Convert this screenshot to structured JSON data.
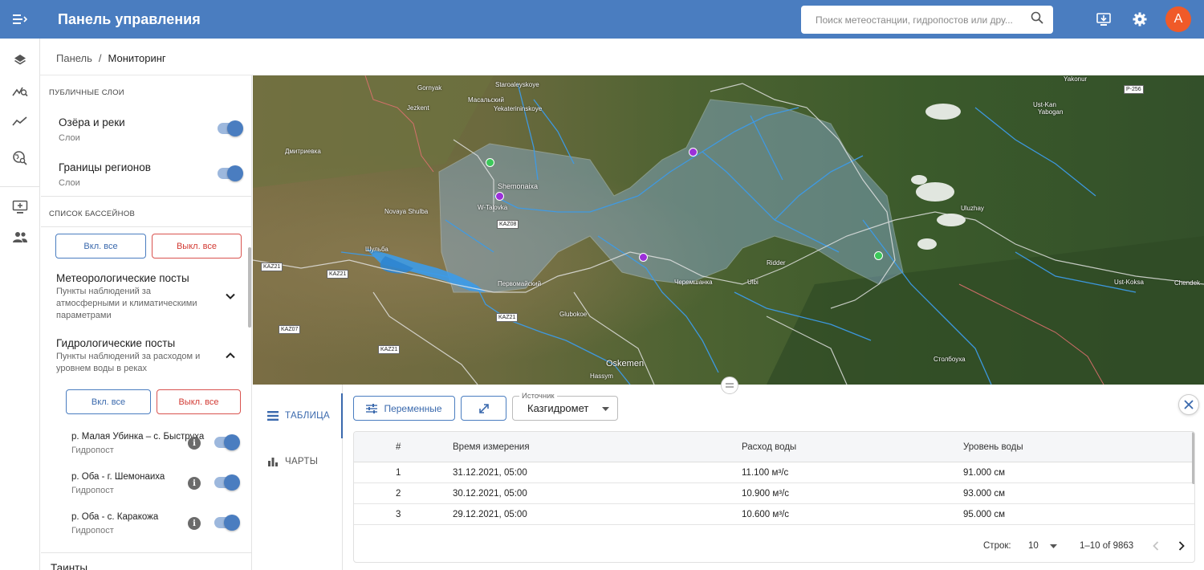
{
  "header": {
    "title": "Панель управления",
    "search_placeholder": "Поиск метеостанции, гидропостов или дру...",
    "avatar_letter": "A"
  },
  "breadcrumb": {
    "root": "Панель",
    "sep": "/",
    "current": "Мониторинг"
  },
  "layers": {
    "public_title": "ПУБЛИЧНЫЕ СЛОИ",
    "items": [
      {
        "name": "Озёра и реки",
        "sub": "Слои",
        "on": true
      },
      {
        "name": "Границы регионов",
        "sub": "Слои",
        "on": true
      }
    ],
    "basins_title": "СПИСОК БАССЕЙНОВ",
    "enable_all": "Вкл. все",
    "disable_all": "Выкл. все",
    "groups": [
      {
        "title": "Метеорологические посты",
        "desc": "Пункты наблюдений за атмосферными и климатическими параметрами",
        "expanded": false
      },
      {
        "title": "Гидрологические посты",
        "desc": "Пункты наблюдений за расходом и уровнем воды в реках",
        "expanded": true
      }
    ],
    "posts": [
      {
        "name": "р. Малая Убинка – с. Быструха",
        "sub": "Гидропост",
        "on": true
      },
      {
        "name": "р. Оба - г. Шемонаиха",
        "sub": "Гидропост",
        "on": true
      },
      {
        "name": "р. Оба - с. Каракожа",
        "sub": "Гидропост",
        "on": true
      }
    ],
    "next_group": "Таинты"
  },
  "map": {
    "labels": [
      {
        "t": "Gornyak"
      },
      {
        "t": "Staroaleyskoye"
      },
      {
        "t": "Масальский"
      },
      {
        "t": "Jezkent"
      },
      {
        "t": "Yekaterininskoye"
      },
      {
        "t": "Дмитриевка"
      },
      {
        "t": "Shemonaixa"
      },
      {
        "t": "W-Talovka"
      },
      {
        "t": "Novaya Shulba"
      },
      {
        "t": "Шульба"
      },
      {
        "t": "Первомайский"
      },
      {
        "t": "Glubokoe"
      },
      {
        "t": "Oskemen"
      },
      {
        "t": "Черемшанка"
      },
      {
        "t": "Ridder"
      },
      {
        "t": "Ulbi"
      },
      {
        "t": "Ust-Kan"
      },
      {
        "t": "Yabogan"
      },
      {
        "t": "Uluzhay"
      },
      {
        "t": "Ust-Koksa"
      },
      {
        "t": "Chendek"
      },
      {
        "t": "Yakonur"
      },
      {
        "t": "Столбоуха"
      },
      {
        "t": "Hassym"
      }
    ],
    "roads": [
      "KAZ21",
      "KAZ21",
      "KAZ07",
      "KAZ21",
      "KAZ21",
      "KAZ08",
      "P-256"
    ],
    "markers": [
      {
        "type": "hydro",
        "color": "#3cc85a"
      },
      {
        "type": "meteo",
        "color": "#9b30d9"
      },
      {
        "type": "meteo",
        "color": "#9b30d9"
      },
      {
        "type": "meteo",
        "color": "#9b30d9"
      },
      {
        "type": "hydro",
        "color": "#3cc85a"
      }
    ]
  },
  "bottom": {
    "tab_table": "ТАБЛИЦА",
    "tab_charts": "ЧАРТЫ",
    "variables_btn": "Переменные",
    "source_label": "Источник",
    "source_value": "Казгидромет",
    "columns": [
      "#",
      "Время измерения",
      "Расход воды",
      "Уровень воды"
    ],
    "rows": [
      [
        "1",
        "31.12.2021, 05:00",
        "11.100 м³/с",
        "91.000 см"
      ],
      [
        "2",
        "30.12.2021, 05:00",
        "10.900 м³/с",
        "93.000 см"
      ],
      [
        "3",
        "29.12.2021, 05:00",
        "10.600 м³/с",
        "95.000 см"
      ]
    ],
    "rows_label": "Строк:",
    "rows_per_page": "10",
    "range": "1–10 of 9863"
  },
  "colors": {
    "primary": "#4a7dc0",
    "danger": "#d9534f",
    "avatar": "#f05a28"
  }
}
